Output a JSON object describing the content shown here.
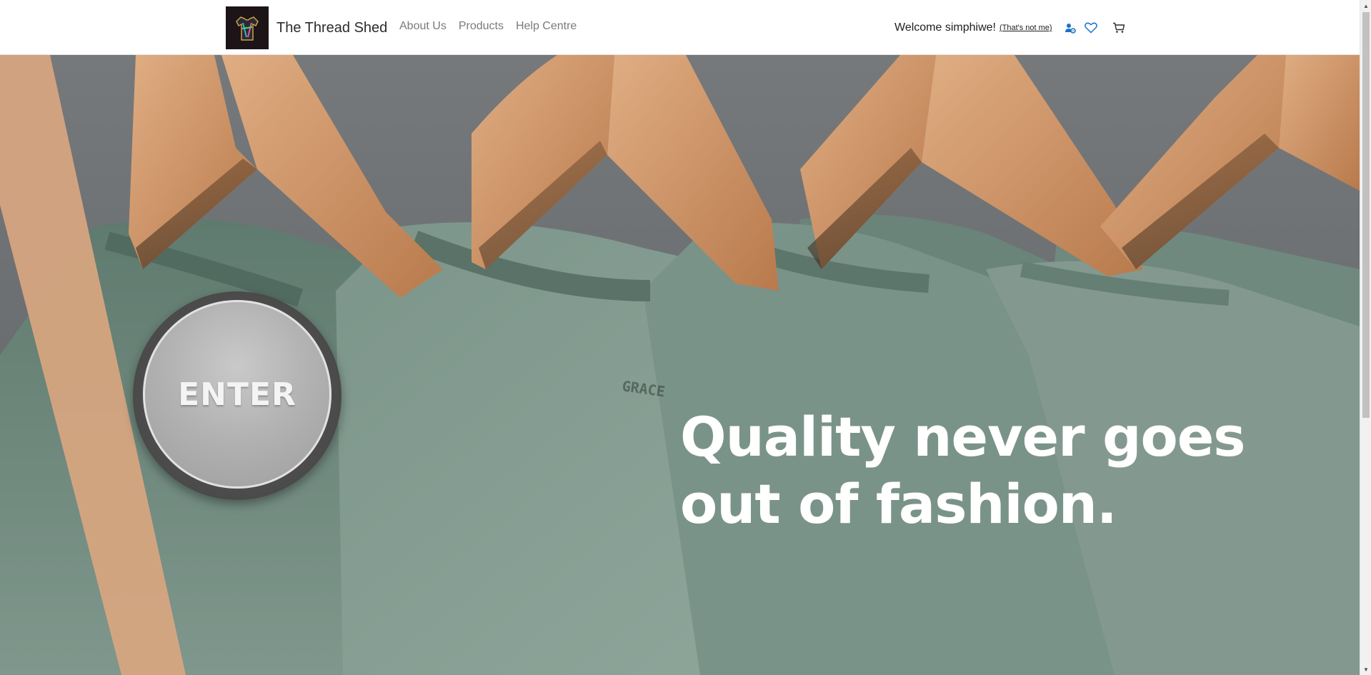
{
  "navbar": {
    "brand_name": "The Thread Shed",
    "logo_icon": "shirt-logo-icon",
    "links": [
      {
        "label": "About Us"
      },
      {
        "label": "Products"
      },
      {
        "label": "Help Centre"
      }
    ],
    "welcome_text": "Welcome simphiwe!",
    "not_me_text": "(That's not me)",
    "icons": [
      "user-settings-icon",
      "heart-icon",
      "cart-icon"
    ],
    "accent_color": "#1a73c9"
  },
  "hero": {
    "enter_label": "ENTER",
    "tagline": "Quality never goes out of fashion.",
    "shirt_color": "#6b8378",
    "hanger_color": "#d39a6e"
  }
}
